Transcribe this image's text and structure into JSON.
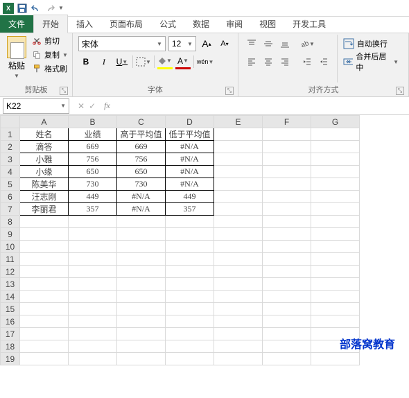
{
  "qat": {
    "logo": "X"
  },
  "tabs": {
    "file": "文件",
    "items": [
      "开始",
      "插入",
      "页面布局",
      "公式",
      "数据",
      "审阅",
      "视图",
      "开发工具"
    ],
    "active_index": 0
  },
  "ribbon": {
    "clipboard": {
      "paste": "粘贴",
      "cut": "剪切",
      "copy": "复制",
      "format_painter": "格式刷",
      "group_label": "剪贴板"
    },
    "font": {
      "name": "宋体",
      "size": "12",
      "grow": "A",
      "shrink": "A",
      "bold": "B",
      "italic": "I",
      "underline": "U",
      "fill": "A",
      "color": "A",
      "wen": "wén",
      "group_label": "字体"
    },
    "alignment": {
      "wrap": "自动换行",
      "merge": "合并后居中",
      "group_label": "对齐方式"
    }
  },
  "namebox": {
    "ref": "K22",
    "fx": "fx"
  },
  "columns": [
    "A",
    "B",
    "C",
    "D",
    "E",
    "F",
    "G"
  ],
  "row_count": 19,
  "table": {
    "headers": [
      "姓名",
      "业绩",
      "高于平均值",
      "低于平均值"
    ],
    "rows": [
      {
        "name": "滴答",
        "score": "669",
        "above": "669",
        "below": "#N/A"
      },
      {
        "name": "小雅",
        "score": "756",
        "above": "756",
        "below": "#N/A"
      },
      {
        "name": "小缘",
        "score": "650",
        "above": "650",
        "below": "#N/A"
      },
      {
        "name": "陈美华",
        "score": "730",
        "above": "730",
        "below": "#N/A"
      },
      {
        "name": "汪志刚",
        "score": "449",
        "above": "#N/A",
        "below": "449"
      },
      {
        "name": "李丽君",
        "score": "357",
        "above": "#N/A",
        "below": "357"
      }
    ]
  },
  "watermark": "部落窝教育"
}
